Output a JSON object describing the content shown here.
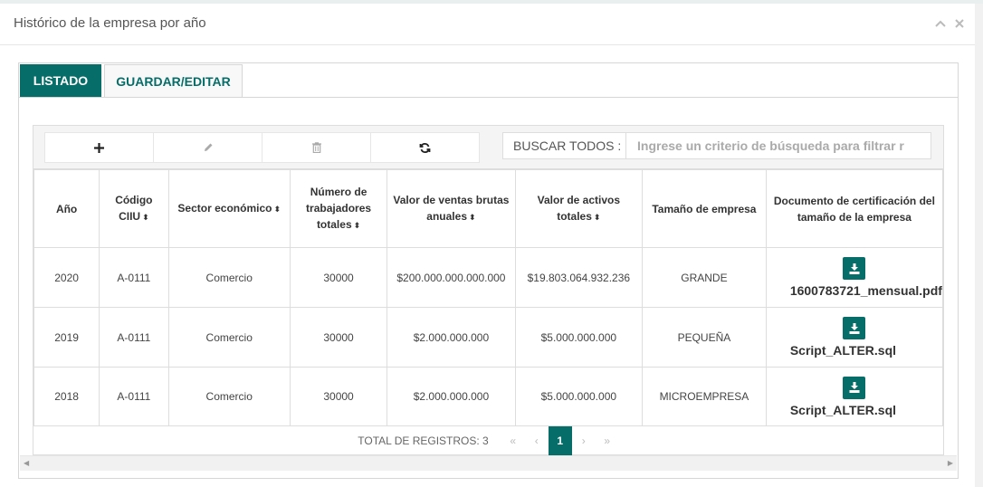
{
  "panel": {
    "title": "Histórico de la empresa por año"
  },
  "tabs": [
    {
      "label": "LISTADO"
    },
    {
      "label": "GUARDAR/EDITAR"
    }
  ],
  "search": {
    "label": "BUSCAR TODOS :",
    "placeholder": "Ingrese un criterio de búsqueda para filtrar r"
  },
  "toolbar_icons": [
    "plus-icon",
    "pencil-icon",
    "trash-icon",
    "refresh-icon"
  ],
  "columns": [
    {
      "label": "Año"
    },
    {
      "label": "Código CIIU"
    },
    {
      "label": "Sector económico"
    },
    {
      "label": "Número de trabajadores totales"
    },
    {
      "label": "Valor de ventas brutas anuales"
    },
    {
      "label": "Valor de activos totales"
    },
    {
      "label": "Tamaño de empresa"
    },
    {
      "label": "Documento de certificación del tamaño de la empresa"
    }
  ],
  "rows": [
    {
      "anio": "2020",
      "ciiu": "A-0111",
      "sector": "Comercio",
      "trabajadores": "30000",
      "ventas": "$200.000.000.000.000",
      "activos": "$19.803.064.932.236",
      "tamano": "GRANDE",
      "documento": "1600783721_mensual.pdf"
    },
    {
      "anio": "2019",
      "ciiu": "A-0111",
      "sector": "Comercio",
      "trabajadores": "30000",
      "ventas": "$2.000.000.000",
      "activos": "$5.000.000.000",
      "tamano": "PEQUEÑA",
      "documento": "Script_ALTER.sql"
    },
    {
      "anio": "2018",
      "ciiu": "A-0111",
      "sector": "Comercio",
      "trabajadores": "30000",
      "ventas": "$2.000.000.000",
      "activos": "$5.000.000.000",
      "tamano": "MICROEMPRESA",
      "documento": "Script_ALTER.sql"
    }
  ],
  "pager": {
    "total": "TOTAL DE REGISTROS: 3",
    "first": "«",
    "prev": "‹",
    "current": "1",
    "next": "›",
    "last": "»"
  },
  "colors": {
    "accent": "#066d68"
  }
}
